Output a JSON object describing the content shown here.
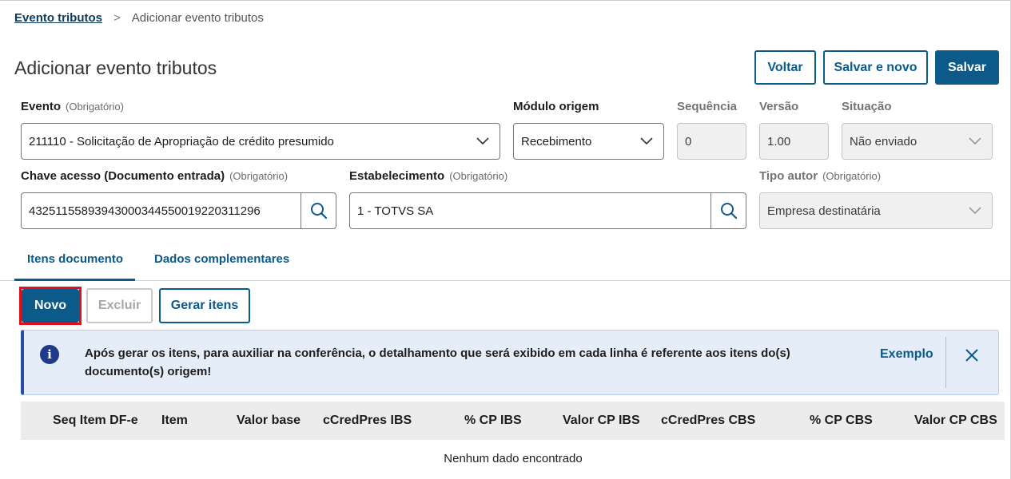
{
  "breadcrumb": {
    "parent": "Evento tributos",
    "separator": ">",
    "current": "Adicionar evento tributos"
  },
  "page": {
    "title": "Adicionar evento tributos"
  },
  "actions": {
    "back": "Voltar",
    "save_new": "Salvar e novo",
    "save": "Salvar"
  },
  "form": {
    "evento": {
      "label": "Evento",
      "required": "(Obrigatório)",
      "value": "211110 - Solicitação de Apropriação de crédito presumido"
    },
    "modulo": {
      "label": "Módulo origem",
      "value": "Recebimento"
    },
    "sequencia": {
      "label": "Sequência",
      "value": "0"
    },
    "versao": {
      "label": "Versão",
      "value": "1.00"
    },
    "situacao": {
      "label": "Situação",
      "value": "Não enviado"
    },
    "chave": {
      "label": "Chave acesso (Documento entrada)",
      "required": "(Obrigatório)",
      "value": "43251155893943000344550019220311296"
    },
    "estabelecimento": {
      "label": "Estabelecimento",
      "required": "(Obrigatório)",
      "value": "1 - TOTVS SA"
    },
    "tipo_autor": {
      "label": "Tipo autor",
      "required": "(Obrigatório)",
      "value": "Empresa destinatária"
    }
  },
  "tabs": [
    {
      "label": "Itens documento",
      "active": true
    },
    {
      "label": "Dados complementares",
      "active": false
    }
  ],
  "toolbar": {
    "new": "Novo",
    "delete": "Excluir",
    "generate": "Gerar itens"
  },
  "alert": {
    "icon": "info-icon",
    "message": "Após gerar os itens, para auxiliar na conferência, o detalhamento que será exibido em cada linha é referente aos itens do(s) documento(s) origem!",
    "link": "Exemplo"
  },
  "table": {
    "columns": [
      "Seq Item DF-e",
      "Item",
      "Valor base",
      "cCredPres IBS",
      "% CP IBS",
      "Valor CP IBS",
      "cCredPres CBS",
      "% CP CBS",
      "Valor CP CBS"
    ],
    "empty_message": "Nenhum dado encontrado"
  },
  "colors": {
    "primary": "#0c5a8a",
    "title_dark": "#0c3b5e",
    "highlight": "#e0101a",
    "alert_bg": "#e4edf8",
    "alert_accent": "#1e3a8a"
  }
}
